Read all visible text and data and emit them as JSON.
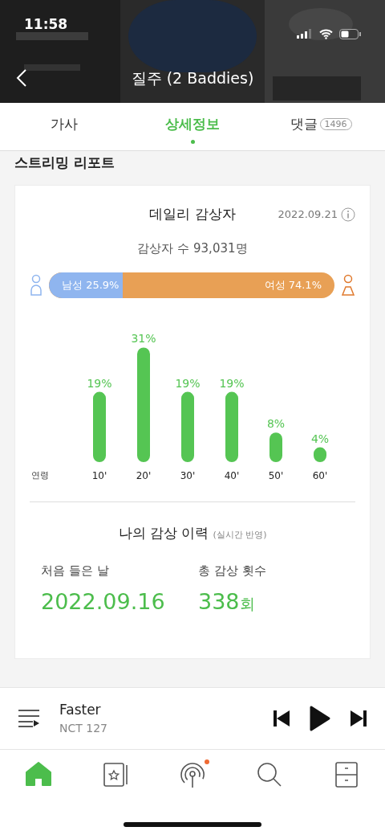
{
  "status_bar": {
    "time": "11:58"
  },
  "header": {
    "title": "질주 (2 Baddies)"
  },
  "tabs": [
    {
      "label": "가사",
      "selected": false
    },
    {
      "label": "상세정보",
      "selected": true
    },
    {
      "label": "댓글",
      "count": "1496",
      "selected": false
    }
  ],
  "section_title": "스트리밍 리포트",
  "daily_listeners": {
    "title": "데일리 감상자",
    "date": "2022.09.21",
    "total": "감상자 수 93,031명",
    "gender": {
      "male_label": "남성 25.9%",
      "female_label": "여성 74.1%",
      "level": 0.259
    },
    "chart_data": {
      "type": "bar",
      "xlabel": "연령",
      "categories": [
        "10'",
        "20'",
        "30'",
        "40'",
        "50'",
        "60'"
      ],
      "values": [
        19,
        31,
        19,
        19,
        8,
        4
      ],
      "value_labels": [
        "19%",
        "31%",
        "19%",
        "19%",
        "8%",
        "4%"
      ]
    }
  },
  "my_history": {
    "title": "나의 감상 이력",
    "note": "(실시간 반영)",
    "stats": [
      {
        "label": "처음 들은 날",
        "value": "2022.09.16"
      },
      {
        "label": "총 감상 횟수",
        "value": "338",
        "unit": "회"
      }
    ]
  },
  "mini_player": {
    "song": "Faster",
    "artist": "NCT 127"
  },
  "bottom_nav": [
    {
      "kind": "home",
      "selected": true
    },
    {
      "kind": "album",
      "selected": false
    },
    {
      "kind": "radio",
      "selected": false,
      "dot": true
    },
    {
      "kind": "search",
      "selected": false
    },
    {
      "kind": "drawer",
      "selected": false
    }
  ]
}
